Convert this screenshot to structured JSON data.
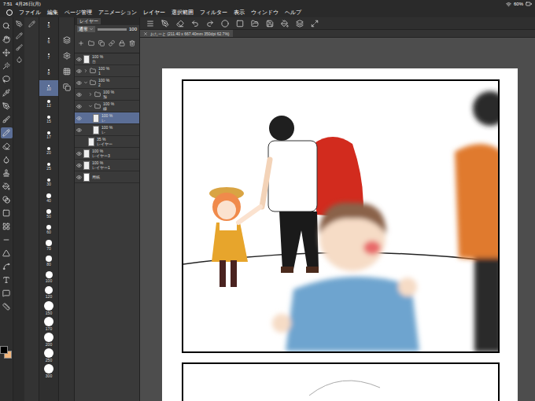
{
  "status_bar": {
    "time": "7:51",
    "date": "4月26日(月)",
    "battery": "60%"
  },
  "menu": [
    "ファイル",
    "編集",
    "ページ管理",
    "アニメーション",
    "レイヤー",
    "選択範囲",
    "フィルター",
    "表示",
    "ウィンドウ",
    "ヘルプ"
  ],
  "document_tab": {
    "title": "おたーと (211.40 x 667.40mm 350dpi 62.7%)"
  },
  "tools": [
    {
      "selected": false
    },
    {
      "selected": false
    },
    {
      "selected": false
    },
    {
      "selected": false
    },
    {
      "selected": false
    },
    {
      "selected": false
    },
    {
      "selected": false
    },
    {
      "selected": false
    },
    {
      "selected": true
    },
    {
      "selected": false
    },
    {
      "selected": false
    },
    {
      "selected": false
    },
    {
      "selected": false
    },
    {
      "selected": false
    },
    {
      "selected": false
    },
    {
      "selected": false
    },
    {
      "selected": false
    },
    {
      "selected": false
    },
    {
      "selected": false
    },
    {
      "selected": false
    },
    {
      "selected": false
    },
    {
      "selected": false
    }
  ],
  "brush_sizes": [
    {
      "label": "5",
      "selected": false
    },
    {
      "label": "6",
      "selected": false
    },
    {
      "label": "7",
      "selected": false
    },
    {
      "label": "8",
      "selected": false
    },
    {
      "label": "10",
      "selected": true
    },
    {
      "label": "12",
      "selected": false
    },
    {
      "label": "15",
      "selected": false
    },
    {
      "label": "17",
      "selected": false
    },
    {
      "label": "20",
      "selected": false
    },
    {
      "label": "25",
      "selected": false
    },
    {
      "label": "30",
      "selected": false
    },
    {
      "label": "40",
      "selected": false
    },
    {
      "label": "50",
      "selected": false
    },
    {
      "label": "60",
      "selected": false
    },
    {
      "label": "70",
      "selected": false
    },
    {
      "label": "80",
      "selected": false
    },
    {
      "label": "100",
      "selected": false
    },
    {
      "label": "120",
      "selected": false
    },
    {
      "label": "150",
      "selected": false
    },
    {
      "label": "170",
      "selected": false
    },
    {
      "label": "200",
      "selected": false
    },
    {
      "label": "250",
      "selected": false
    },
    {
      "label": "300",
      "selected": false
    }
  ],
  "layer_panel": {
    "title": "レイヤー",
    "blend_mode": "通常",
    "opacity": "100",
    "layers": [
      {
        "opacity": "100 %",
        "name": "台",
        "kind": "layer",
        "depth": 0,
        "visible": true,
        "selected": false
      },
      {
        "opacity": "100 %",
        "name": "1",
        "kind": "folder",
        "depth": 0,
        "visible": true,
        "selected": false,
        "expanded": false
      },
      {
        "opacity": "100 %",
        "name": "2",
        "kind": "folder",
        "depth": 0,
        "visible": true,
        "selected": false,
        "expanded": true
      },
      {
        "opacity": "100 %",
        "name": "加",
        "kind": "folder",
        "depth": 1,
        "visible": true,
        "selected": false,
        "expanded": false
      },
      {
        "opacity": "100 %",
        "name": "線",
        "kind": "folder",
        "depth": 1,
        "visible": true,
        "selected": false,
        "expanded": true
      },
      {
        "opacity": "100 %",
        "name": "レ",
        "kind": "layer",
        "depth": 2,
        "visible": true,
        "selected": true
      },
      {
        "opacity": "100 %",
        "name": "レ",
        "kind": "layer",
        "depth": 2,
        "visible": true,
        "selected": false
      },
      {
        "opacity": "35 %",
        "name": "レイヤー",
        "kind": "layer",
        "depth": 1,
        "visible": false,
        "selected": false
      },
      {
        "opacity": "100 %",
        "name": "レイヤー3",
        "kind": "layer",
        "depth": 0,
        "visible": true,
        "selected": false
      },
      {
        "opacity": "100 %",
        "name": "レイヤー1",
        "kind": "layer",
        "depth": 0,
        "visible": true,
        "selected": false
      },
      {
        "opacity": "",
        "name": "用紙",
        "kind": "paper",
        "depth": 0,
        "visible": true,
        "selected": false
      }
    ]
  },
  "colors": {
    "main": "#000000",
    "sub": "#f2b77e"
  }
}
